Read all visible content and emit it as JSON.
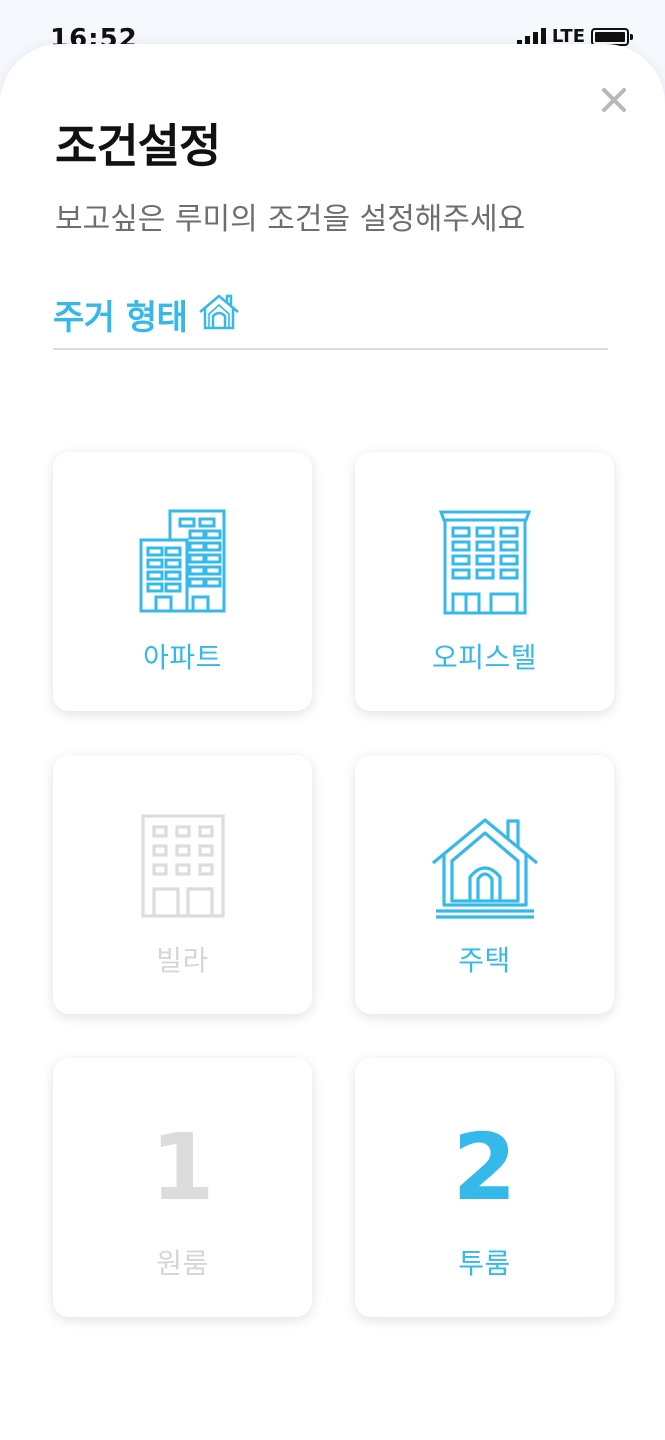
{
  "status_bar": {
    "time": "16:52",
    "network": "LTE"
  },
  "modal": {
    "title": "조건설정",
    "subtitle": "보고싶은 루미의 조건을 설정해주세요",
    "close_icon": "close-icon",
    "section_label": "주거 형태",
    "section_icon": "house-outline-icon"
  },
  "colors": {
    "accent": "#35b9ea",
    "inactive": "#d6d6d6",
    "title": "#111111",
    "subtitle": "#6e6e6e"
  },
  "options": [
    {
      "label": "아파트",
      "icon": "apartment-icon",
      "selected": true
    },
    {
      "label": "오피스텔",
      "icon": "officetel-icon",
      "selected": true
    },
    {
      "label": "빌라",
      "icon": "villa-icon",
      "selected": false
    },
    {
      "label": "주택",
      "icon": "house-icon",
      "selected": true
    },
    {
      "label": "원룸",
      "number": "1",
      "selected": false
    },
    {
      "label": "투룸",
      "number": "2",
      "selected": true
    }
  ]
}
